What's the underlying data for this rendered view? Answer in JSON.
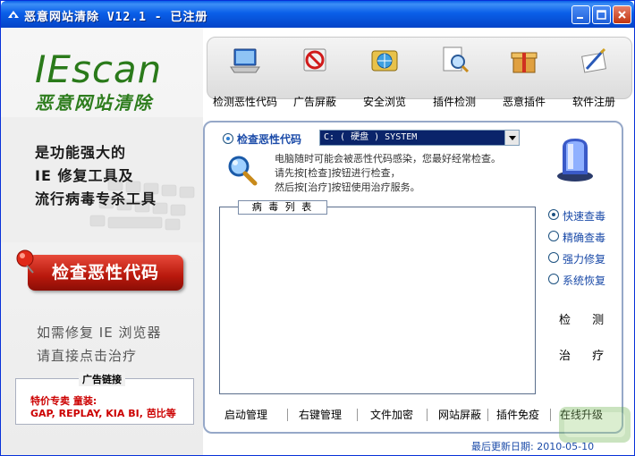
{
  "window": {
    "title": "恶意网站清除 V12.1 - 已注册"
  },
  "brand": {
    "logo_ie": "IE",
    "logo_scan": "scan",
    "logo_sub": "恶意网站清除",
    "slogans": [
      "是功能强大的",
      "IE 修复工具及",
      "流行病毒专杀工具"
    ]
  },
  "left": {
    "check_button_label": "检查恶性代码",
    "hint_lines": [
      "如需修复 IE 浏览器",
      "请直接点击治疗"
    ],
    "ad": {
      "title": "广告链接",
      "line1": "特价专卖 童装:",
      "line2": "GAP, REPLAY, KIA BI, 芭比等"
    }
  },
  "toolbar": {
    "items": [
      {
        "label": "检测恶性代码",
        "icon": "laptop-icon"
      },
      {
        "label": "广告屏蔽",
        "icon": "no-entry-icon"
      },
      {
        "label": "安全浏览",
        "icon": "globe-tv-icon"
      },
      {
        "label": "插件检测",
        "icon": "magnifier-doc-icon"
      },
      {
        "label": "恶意插件",
        "icon": "gift-box-icon"
      },
      {
        "label": "软件注册",
        "icon": "pen-paper-icon"
      }
    ]
  },
  "scan": {
    "option_label": "检查恶性代码",
    "drive_value": "C: ( 硬盘 ) SYSTEM",
    "info_lines": [
      "电脑随时可能会被恶性代码感染，您最好经常检查。",
      "请先按[检查]按钮进行检查，",
      "然后按[治疗]按钮使用治疗服务。"
    ],
    "virus_list_title": "病 毒 列 表"
  },
  "modes": [
    {
      "label": "快速查毒",
      "selected": true
    },
    {
      "label": "精确查毒",
      "selected": false
    },
    {
      "label": "强力修复",
      "selected": false
    },
    {
      "label": "系统恢复",
      "selected": false
    }
  ],
  "actions": {
    "detect": "检 测",
    "treat": "治 疗"
  },
  "bottom": {
    "items": [
      "启动管理",
      "右键管理",
      "文件加密",
      "网站屏蔽",
      "插件免疫",
      "在线升级"
    ]
  },
  "status": {
    "last_update": "最后更新日期: 2010-05-10"
  },
  "colors": {
    "titlebar": "#0a5fe8",
    "accent_green": "#2a7a1a",
    "check_button_red": "#b8180c",
    "link_blue": "#1a4aa8",
    "ad_red": "#cc0000"
  }
}
